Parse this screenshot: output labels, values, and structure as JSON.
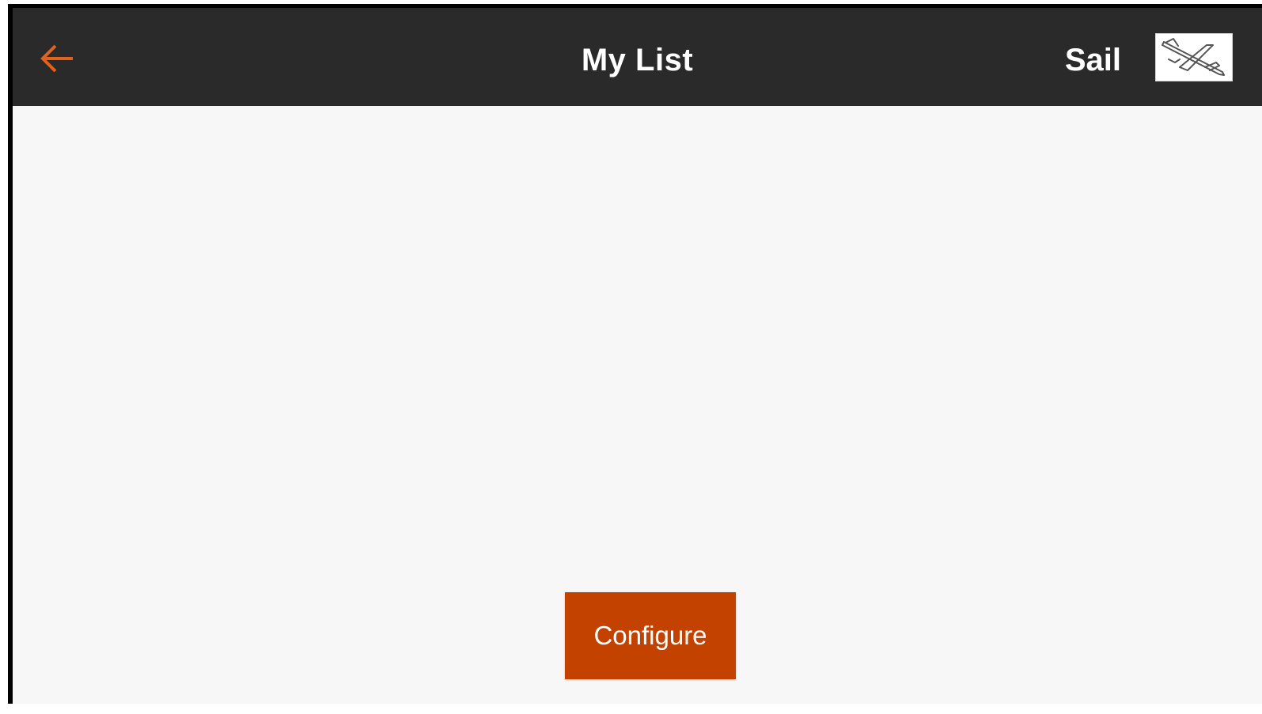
{
  "header": {
    "title": "My List",
    "model_name": "Sail",
    "back_icon": "arrow-left-icon",
    "model_icon": "airplane-icon"
  },
  "main": {
    "configure_label": "Configure"
  },
  "colors": {
    "header_bg": "#2a2a2a",
    "accent": "#e0621c",
    "button_bg": "#c44200",
    "content_bg": "#f7f7f7"
  }
}
